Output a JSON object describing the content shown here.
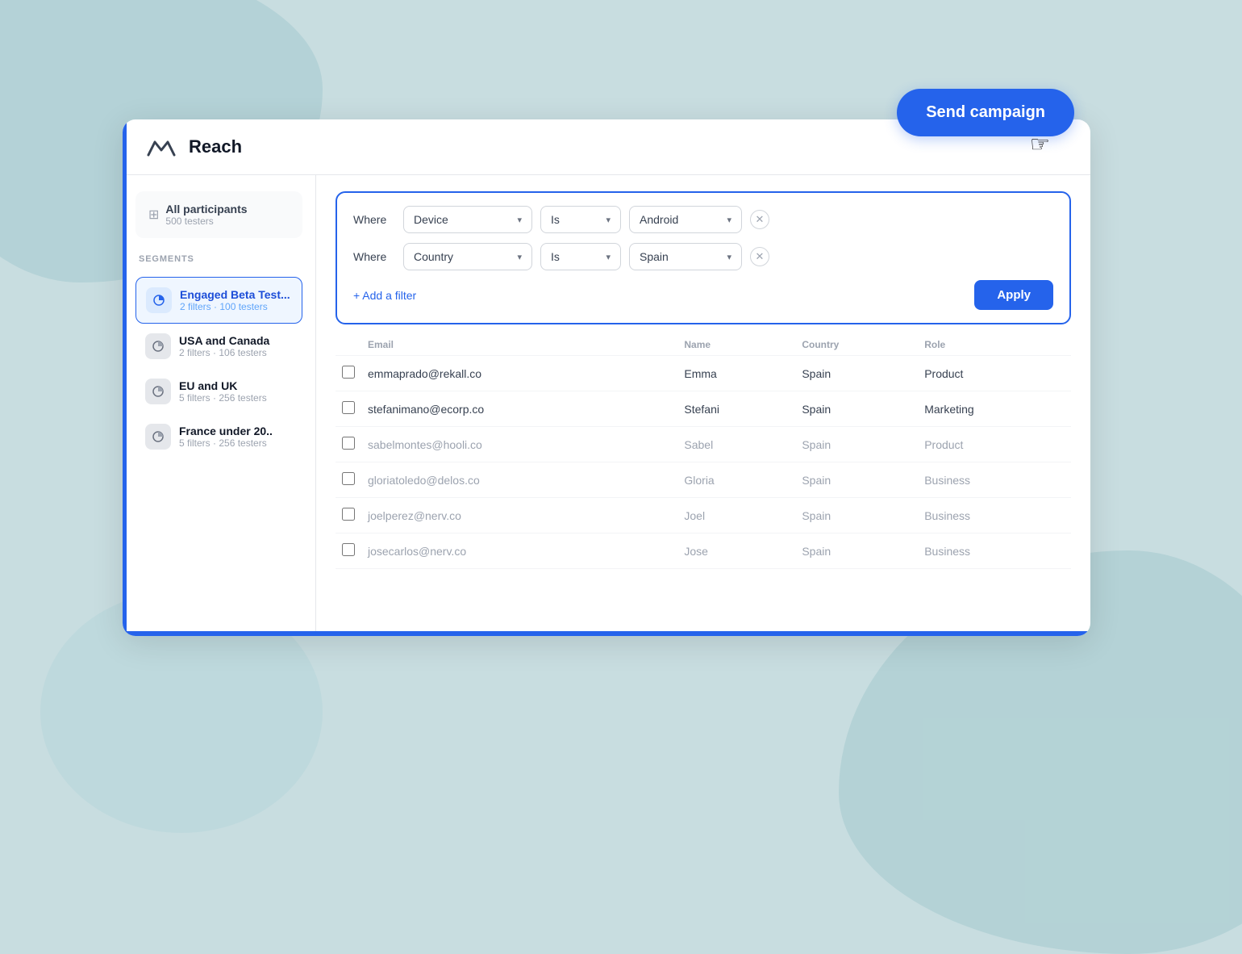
{
  "page": {
    "background": "#c8dde0"
  },
  "header": {
    "logo_alt": "Maze logo",
    "title": "Reach",
    "send_campaign_label": "Send campaign"
  },
  "sidebar": {
    "all_participants": {
      "label": "All participants",
      "count": "500 testers"
    },
    "segments_label": "SEGMENTS",
    "segments": [
      {
        "id": "engaged-beta",
        "name": "Engaged Beta Test...",
        "meta": "2 filters · 100 testers",
        "active": true
      },
      {
        "id": "usa-canada",
        "name": "USA and Canada",
        "meta": "2 filters · 106 testers",
        "active": false
      },
      {
        "id": "eu-uk",
        "name": "EU and UK",
        "meta": "5 filters · 256 testers",
        "active": false
      },
      {
        "id": "france-under",
        "name": "France under 20..",
        "meta": "5 filters · 256 testers",
        "active": false
      }
    ]
  },
  "filters": {
    "filter1": {
      "label": "Where",
      "field": "Device",
      "operator": "Is",
      "value": "Android"
    },
    "filter2": {
      "label": "Where",
      "field": "Country",
      "operator": "Is",
      "value": "Spain"
    },
    "add_filter_label": "+ Add a filter",
    "apply_label": "Apply"
  },
  "table": {
    "rows": [
      {
        "email": "emmaprado@rekall.co",
        "name": "Emma",
        "country": "Spain",
        "role": "Product",
        "dim": false,
        "checked": false
      },
      {
        "email": "stefanimano@ecorp.co",
        "name": "Stefani",
        "country": "Spain",
        "role": "Marketing",
        "dim": false,
        "checked": false
      },
      {
        "email": "sabelmontes@hooli.co",
        "name": "Sabel",
        "country": "Spain",
        "role": "Product",
        "dim": true,
        "checked": false
      },
      {
        "email": "gloriatoledo@delos.co",
        "name": "Gloria",
        "country": "Spain",
        "role": "Business",
        "dim": true,
        "checked": false
      },
      {
        "email": "joelperez@nerv.co",
        "name": "Joel",
        "country": "Spain",
        "role": "Business",
        "dim": true,
        "checked": false
      },
      {
        "email": "josecarlos@nerv.co",
        "name": "Jose",
        "country": "Spain",
        "role": "Business",
        "dim": true,
        "checked": false
      }
    ]
  }
}
